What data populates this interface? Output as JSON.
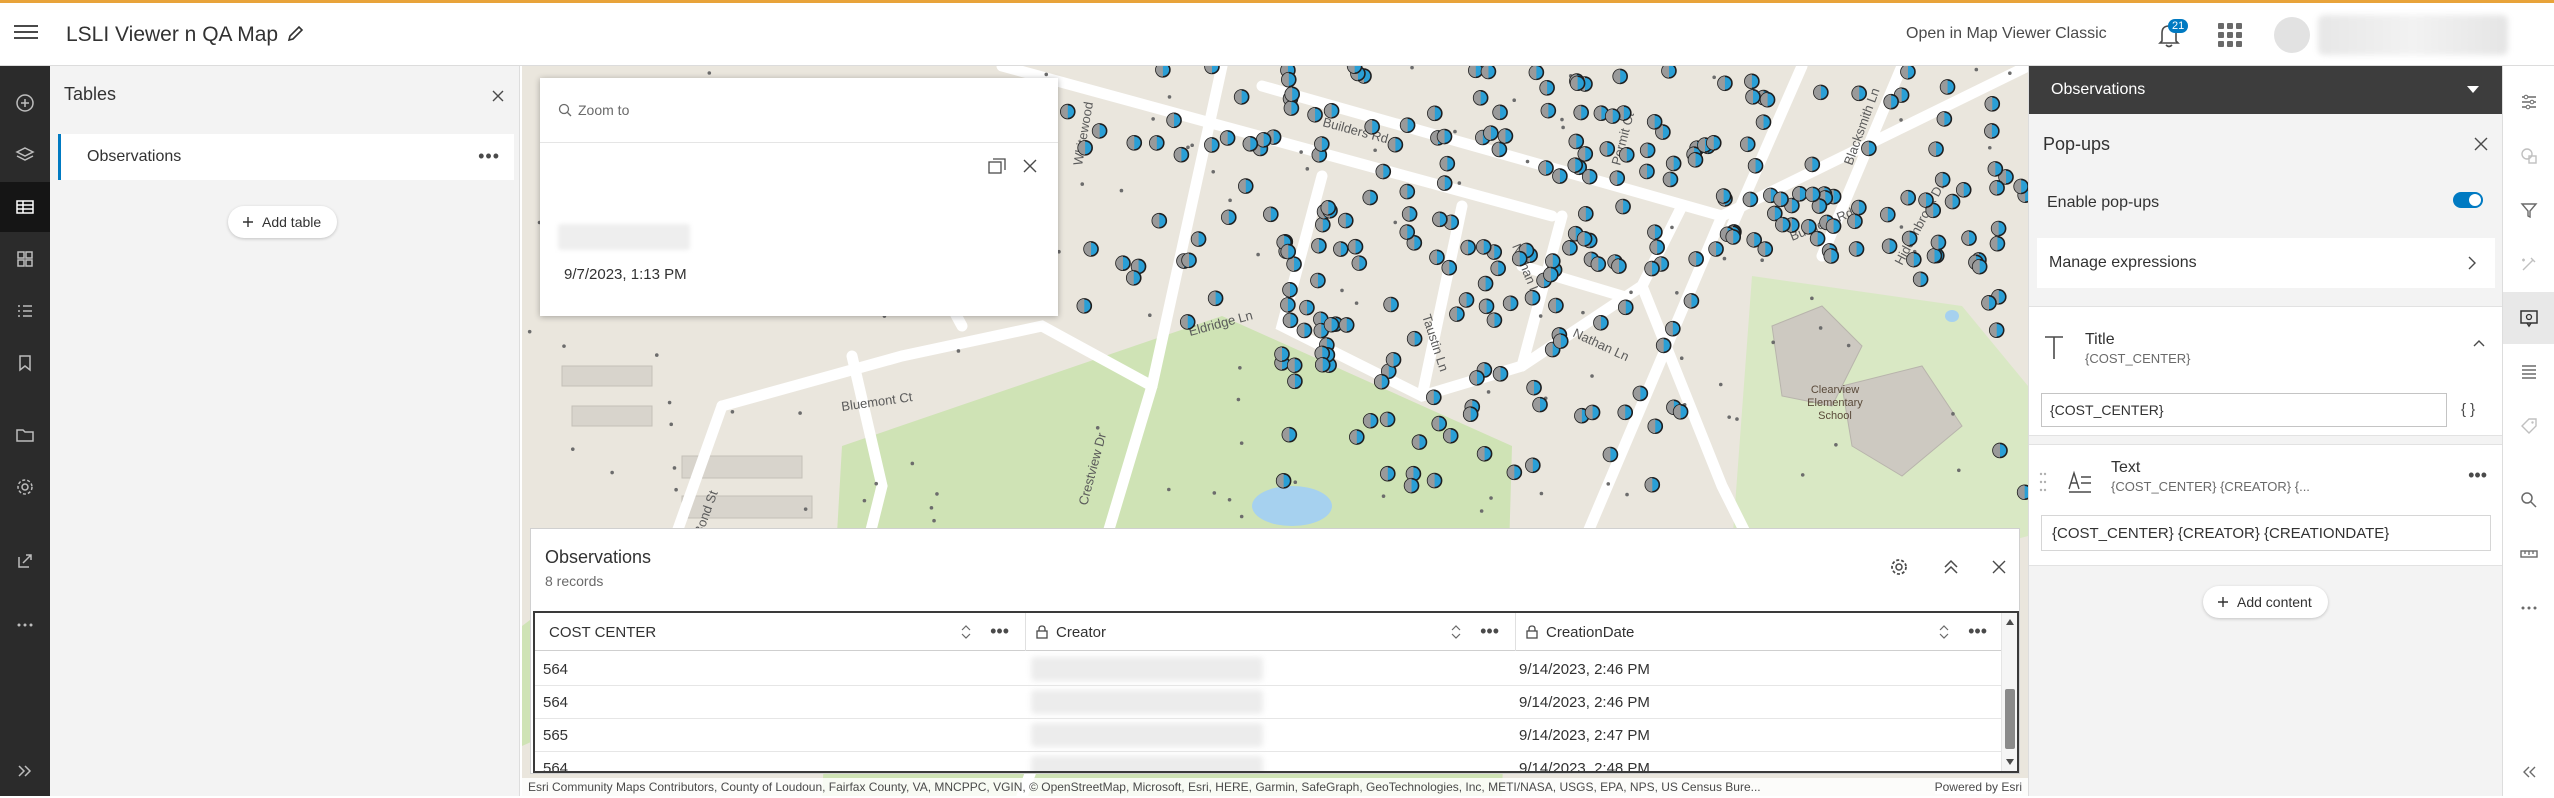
{
  "header": {
    "app_title": "LSLI Viewer n QA Map",
    "open_classic": "Open in Map Viewer Classic",
    "notification_count": "21"
  },
  "tables_panel": {
    "title": "Tables",
    "items": [
      {
        "label": "Observations"
      }
    ],
    "add_table": "Add table"
  },
  "popup": {
    "zoom_to": "Zoom to",
    "date": "9/7/2023, 1:13 PM"
  },
  "observations": {
    "title": "Observations",
    "count": "8 records",
    "columns": [
      "COST CENTER",
      "Creator",
      "CreationDate"
    ],
    "rows": [
      {
        "cost_center": "564",
        "creation_date": "9/14/2023, 2:46 PM"
      },
      {
        "cost_center": "564",
        "creation_date": "9/14/2023, 2:46 PM"
      },
      {
        "cost_center": "565",
        "creation_date": "9/14/2023, 2:47 PM"
      },
      {
        "cost_center": "564",
        "creation_date": "9/14/2023, 2:48 PM"
      }
    ]
  },
  "attribution": {
    "text": "Esri Community Maps Contributors, County of Loudoun, Fairfax County, VA, MNCPPC, VGIN, © OpenStreetMap, Microsoft, Esri, HERE, Garmin, SafeGraph, GeoTechnologies, Inc, METI/NASA, USGS, EPA, NPS, US Census Bure...",
    "powered": "Powered by Esri"
  },
  "map_labels": {
    "builders_rd_1": "Builders Rd",
    "builders_rd_2": "Builders Rd",
    "eldridge": "Eldridge Ln",
    "bluemont": "Bluemont Ct",
    "crestview": "Crestview Dr",
    "bond": "Bond St",
    "nathan_1": "Nathan Ln",
    "nathan_2": "Nathan Ln",
    "taustin": "Taustin Ln",
    "permit": "Permit Ct",
    "blacksmith": "Blacksmith Ln",
    "hiddenbrook": "Hiddenbrook Dr",
    "whitewood": "Whitewood",
    "school": "Clearview Elementary School"
  },
  "popups_panel": {
    "layer": "Observations",
    "title": "Pop-ups",
    "enable": "Enable pop-ups",
    "enabled": true,
    "manage": "Manage expressions",
    "title_card": {
      "label": "Title",
      "sub": "{COST_CENTER}",
      "value": "{COST_CENTER}",
      "braces": "{ }"
    },
    "text_card": {
      "label": "Text",
      "sub": "{COST_CENTER} {CREATOR} {...",
      "value": "{COST_CENTER} {CREATOR} {CREATIONDATE}"
    },
    "add_content": "Add content"
  },
  "colors": {
    "accent": "#007ac2",
    "rail": "#2b2b2b",
    "header_stripe": "#e8a33a"
  }
}
